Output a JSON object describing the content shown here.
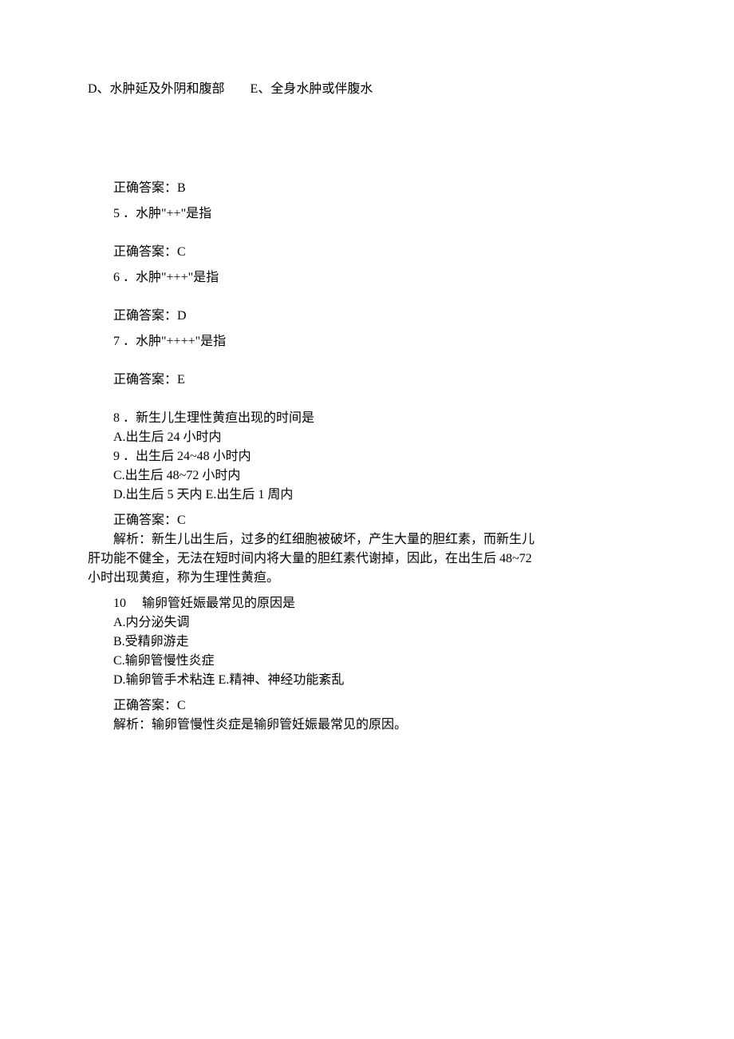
{
  "topLine": "D、水肿延及外阴和腹部　　E、全身水肿或伴腹水",
  "q4_answer": "正确答案：B",
  "q5_text": "5 ．水肿\"++\"是指",
  "q5_answer": "正确答案：C",
  "q6_text": "6 ．水肿\"+++\"是指",
  "q6_answer": "正确答案：D",
  "q7_text": "7 ．水肿\"++++\"是指",
  "q7_answer": "正确答案：E",
  "q8_text": "8 ．新生儿生理性黄疸出现的时间是",
  "q8_optA": "A.出生后 24 小时内",
  "q8_optB": "9 ．出生后 24~48 小时内",
  "q8_optC": "C.出生后 48~72 小时内",
  "q8_optDE": "D.出生后 5 天内 E.出生后 1 周内",
  "q8_answer": "正确答案：C",
  "q8_expl1": "解析：新生儿出生后，过多的红细胞被破坏，产生大量的胆红素，而新生儿",
  "q8_expl2": "肝功能不健全，无法在短时间内将大量的胆红素代谢掉，因此，在出生后 48~72",
  "q8_expl3": "小时出现黄疸，称为生理性黄疸。",
  "q10_text": "10　 输卵管妊娠最常见的原因是",
  "q10_optA": "A.内分泌失调",
  "q10_optB": "B.受精卵游走",
  "q10_optC": "C.输卵管慢性炎症",
  "q10_optDE": "D.输卵管手术粘连 E.精神、神经功能紊乱",
  "q10_answer": "正确答案：C",
  "q10_expl": "解析：输卵管慢性炎症是输卵管妊娠最常见的原因。"
}
